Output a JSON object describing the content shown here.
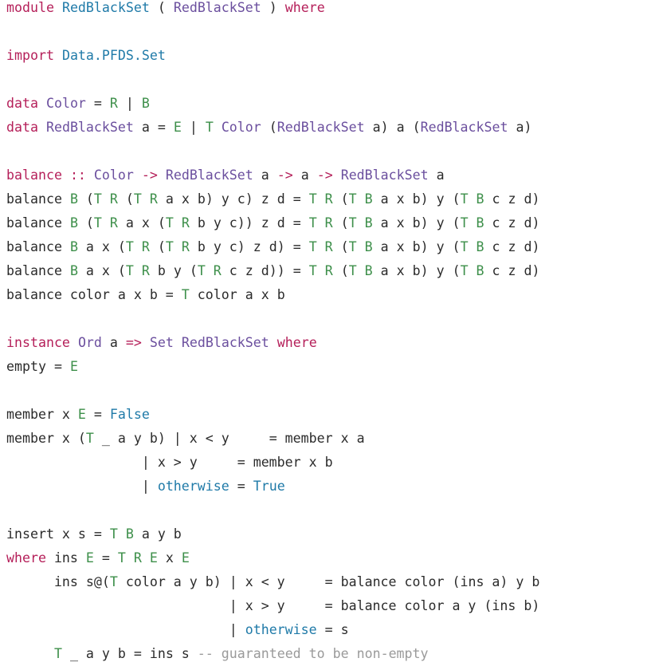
{
  "palette": {
    "keyword": "#b5205a",
    "type": "#6b4f9e",
    "constructor": "#3d8f4a",
    "special": "#1f7aa8",
    "comment": "#9a9a9a",
    "text": "#2b2b2b",
    "background": "#ffffff"
  },
  "lines": [
    [
      [
        "kw",
        "module"
      ],
      [
        "tx",
        " "
      ],
      [
        "sp",
        "RedBlackSet"
      ],
      [
        "tx",
        " ( "
      ],
      [
        "ty",
        "RedBlackSet"
      ],
      [
        "tx",
        " ) "
      ],
      [
        "kw",
        "where"
      ]
    ],
    [],
    [
      [
        "kw",
        "import"
      ],
      [
        "tx",
        " "
      ],
      [
        "sp",
        "Data.PFDS.Set"
      ]
    ],
    [],
    [
      [
        "kw",
        "data"
      ],
      [
        "tx",
        " "
      ],
      [
        "ty",
        "Color"
      ],
      [
        "tx",
        " = "
      ],
      [
        "ct",
        "R"
      ],
      [
        "tx",
        " | "
      ],
      [
        "ct",
        "B"
      ]
    ],
    [
      [
        "kw",
        "data"
      ],
      [
        "tx",
        " "
      ],
      [
        "ty",
        "RedBlackSet"
      ],
      [
        "tx",
        " a = "
      ],
      [
        "ct",
        "E"
      ],
      [
        "tx",
        " | "
      ],
      [
        "ct",
        "T"
      ],
      [
        "tx",
        " "
      ],
      [
        "ty",
        "Color"
      ],
      [
        "tx",
        " ("
      ],
      [
        "ty",
        "RedBlackSet"
      ],
      [
        "tx",
        " a) a ("
      ],
      [
        "ty",
        "RedBlackSet"
      ],
      [
        "tx",
        " a)"
      ]
    ],
    [],
    [
      [
        "kw",
        "balance"
      ],
      [
        "tx",
        " "
      ],
      [
        "kw",
        "::"
      ],
      [
        "tx",
        " "
      ],
      [
        "ty",
        "Color"
      ],
      [
        "tx",
        " "
      ],
      [
        "kw",
        "->"
      ],
      [
        "tx",
        " "
      ],
      [
        "ty",
        "RedBlackSet"
      ],
      [
        "tx",
        " a "
      ],
      [
        "kw",
        "->"
      ],
      [
        "tx",
        " a "
      ],
      [
        "kw",
        "->"
      ],
      [
        "tx",
        " "
      ],
      [
        "ty",
        "RedBlackSet"
      ],
      [
        "tx",
        " a"
      ]
    ],
    [
      [
        "tx",
        "balance "
      ],
      [
        "ct",
        "B"
      ],
      [
        "tx",
        " ("
      ],
      [
        "ct",
        "T R"
      ],
      [
        "tx",
        " ("
      ],
      [
        "ct",
        "T R"
      ],
      [
        "tx",
        " a x b) y c) z d = "
      ],
      [
        "ct",
        "T R"
      ],
      [
        "tx",
        " ("
      ],
      [
        "ct",
        "T B"
      ],
      [
        "tx",
        " a x b) y ("
      ],
      [
        "ct",
        "T B"
      ],
      [
        "tx",
        " c z d)"
      ]
    ],
    [
      [
        "tx",
        "balance "
      ],
      [
        "ct",
        "B"
      ],
      [
        "tx",
        " ("
      ],
      [
        "ct",
        "T R"
      ],
      [
        "tx",
        " a x ("
      ],
      [
        "ct",
        "T R"
      ],
      [
        "tx",
        " b y c)) z d = "
      ],
      [
        "ct",
        "T R"
      ],
      [
        "tx",
        " ("
      ],
      [
        "ct",
        "T B"
      ],
      [
        "tx",
        " a x b) y ("
      ],
      [
        "ct",
        "T B"
      ],
      [
        "tx",
        " c z d)"
      ]
    ],
    [
      [
        "tx",
        "balance "
      ],
      [
        "ct",
        "B"
      ],
      [
        "tx",
        " a x ("
      ],
      [
        "ct",
        "T R"
      ],
      [
        "tx",
        " ("
      ],
      [
        "ct",
        "T R"
      ],
      [
        "tx",
        " b y c) z d) = "
      ],
      [
        "ct",
        "T R"
      ],
      [
        "tx",
        " ("
      ],
      [
        "ct",
        "T B"
      ],
      [
        "tx",
        " a x b) y ("
      ],
      [
        "ct",
        "T B"
      ],
      [
        "tx",
        " c z d)"
      ]
    ],
    [
      [
        "tx",
        "balance "
      ],
      [
        "ct",
        "B"
      ],
      [
        "tx",
        " a x ("
      ],
      [
        "ct",
        "T R"
      ],
      [
        "tx",
        " b y ("
      ],
      [
        "ct",
        "T R"
      ],
      [
        "tx",
        " c z d)) = "
      ],
      [
        "ct",
        "T R"
      ],
      [
        "tx",
        " ("
      ],
      [
        "ct",
        "T B"
      ],
      [
        "tx",
        " a x b) y ("
      ],
      [
        "ct",
        "T B"
      ],
      [
        "tx",
        " c z d)"
      ]
    ],
    [
      [
        "tx",
        "balance color a x b = "
      ],
      [
        "ct",
        "T"
      ],
      [
        "tx",
        " color a x b"
      ]
    ],
    [],
    [
      [
        "kw",
        "instance"
      ],
      [
        "tx",
        " "
      ],
      [
        "ty",
        "Ord"
      ],
      [
        "tx",
        " a "
      ],
      [
        "kw",
        "=>"
      ],
      [
        "tx",
        " "
      ],
      [
        "ty",
        "Set"
      ],
      [
        "tx",
        " "
      ],
      [
        "ty",
        "RedBlackSet"
      ],
      [
        "tx",
        " "
      ],
      [
        "kw",
        "where"
      ]
    ],
    [
      [
        "tx",
        "empty = "
      ],
      [
        "ct",
        "E"
      ]
    ],
    [],
    [
      [
        "tx",
        "member x "
      ],
      [
        "ct",
        "E"
      ],
      [
        "tx",
        " = "
      ],
      [
        "sp",
        "False"
      ]
    ],
    [
      [
        "tx",
        "member x ("
      ],
      [
        "ct",
        "T"
      ],
      [
        "tx",
        " _ a y b) | x < y     = member x a"
      ]
    ],
    [
      [
        "tx",
        "                 | x > y     = member x b"
      ]
    ],
    [
      [
        "tx",
        "                 | "
      ],
      [
        "sp",
        "otherwise"
      ],
      [
        "tx",
        " = "
      ],
      [
        "sp",
        "True"
      ]
    ],
    [],
    [
      [
        "tx",
        "insert x s = "
      ],
      [
        "ct",
        "T B"
      ],
      [
        "tx",
        " a y b"
      ]
    ],
    [
      [
        "kw",
        "where"
      ],
      [
        "tx",
        " ins "
      ],
      [
        "ct",
        "E"
      ],
      [
        "tx",
        " = "
      ],
      [
        "ct",
        "T R E"
      ],
      [
        "tx",
        " x "
      ],
      [
        "ct",
        "E"
      ]
    ],
    [
      [
        "tx",
        "      ins s@("
      ],
      [
        "ct",
        "T"
      ],
      [
        "tx",
        " color a y b) | x < y     = balance color (ins a) y b"
      ]
    ],
    [
      [
        "tx",
        "                            | x > y     = balance color a y (ins b)"
      ]
    ],
    [
      [
        "tx",
        "                            | "
      ],
      [
        "sp",
        "otherwise"
      ],
      [
        "tx",
        " = s"
      ]
    ],
    [
      [
        "tx",
        "      "
      ],
      [
        "ct",
        "T"
      ],
      [
        "tx",
        " _ a y b = ins s "
      ],
      [
        "cm",
        "-- guaranteed to be non-empty"
      ]
    ]
  ]
}
